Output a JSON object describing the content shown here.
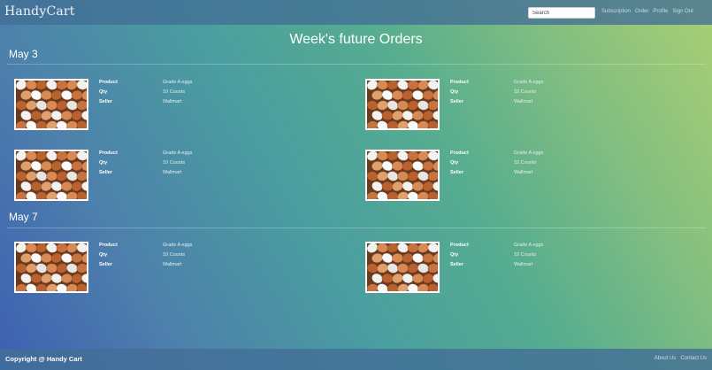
{
  "header": {
    "logo": "HandyCart",
    "search_placeholder": "Search",
    "nav": [
      "Subscription",
      "Order",
      "Profile",
      "Sign Out"
    ]
  },
  "page_title": "Week's future Orders",
  "days": [
    {
      "label": "May 3",
      "orders": [
        {
          "product_label": "Product",
          "product": "Grade A eggs",
          "qty_label": "Qty",
          "qty": "10 Counts",
          "seller_label": "Seller",
          "seller": "Wallmart",
          "image": "eggs-image"
        },
        {
          "product_label": "Product",
          "product": "Grade A eggs",
          "qty_label": "Qty",
          "qty": "10 Counts",
          "seller_label": "Seller",
          "seller": "Wallmart",
          "image": "eggs-image"
        },
        {
          "product_label": "Product",
          "product": "Grade A eggs",
          "qty_label": "Qty",
          "qty": "10 Counts",
          "seller_label": "Seller",
          "seller": "Wallmart",
          "image": "eggs-image"
        },
        {
          "product_label": "Product",
          "product": "Grade A eggs",
          "qty_label": "Qty",
          "qty": "10 Counts",
          "seller_label": "Seller",
          "seller": "Wallmart",
          "image": "eggs-image"
        }
      ]
    },
    {
      "label": "May 7",
      "orders": [
        {
          "product_label": "Product",
          "product": "Grade A eggs",
          "qty_label": "Qty",
          "qty": "10 Counts",
          "seller_label": "Seller",
          "seller": "Wallmart",
          "image": "eggs-image"
        },
        {
          "product_label": "Product",
          "product": "Grade A eggs",
          "qty_label": "Qty",
          "qty": "10 Counts",
          "seller_label": "Seller",
          "seller": "Wallmart",
          "image": "eggs-image"
        }
      ]
    }
  ],
  "footer": {
    "copyright": "Copyright @ Handy Cart",
    "links": [
      "About Us",
      "Contact Us"
    ]
  }
}
